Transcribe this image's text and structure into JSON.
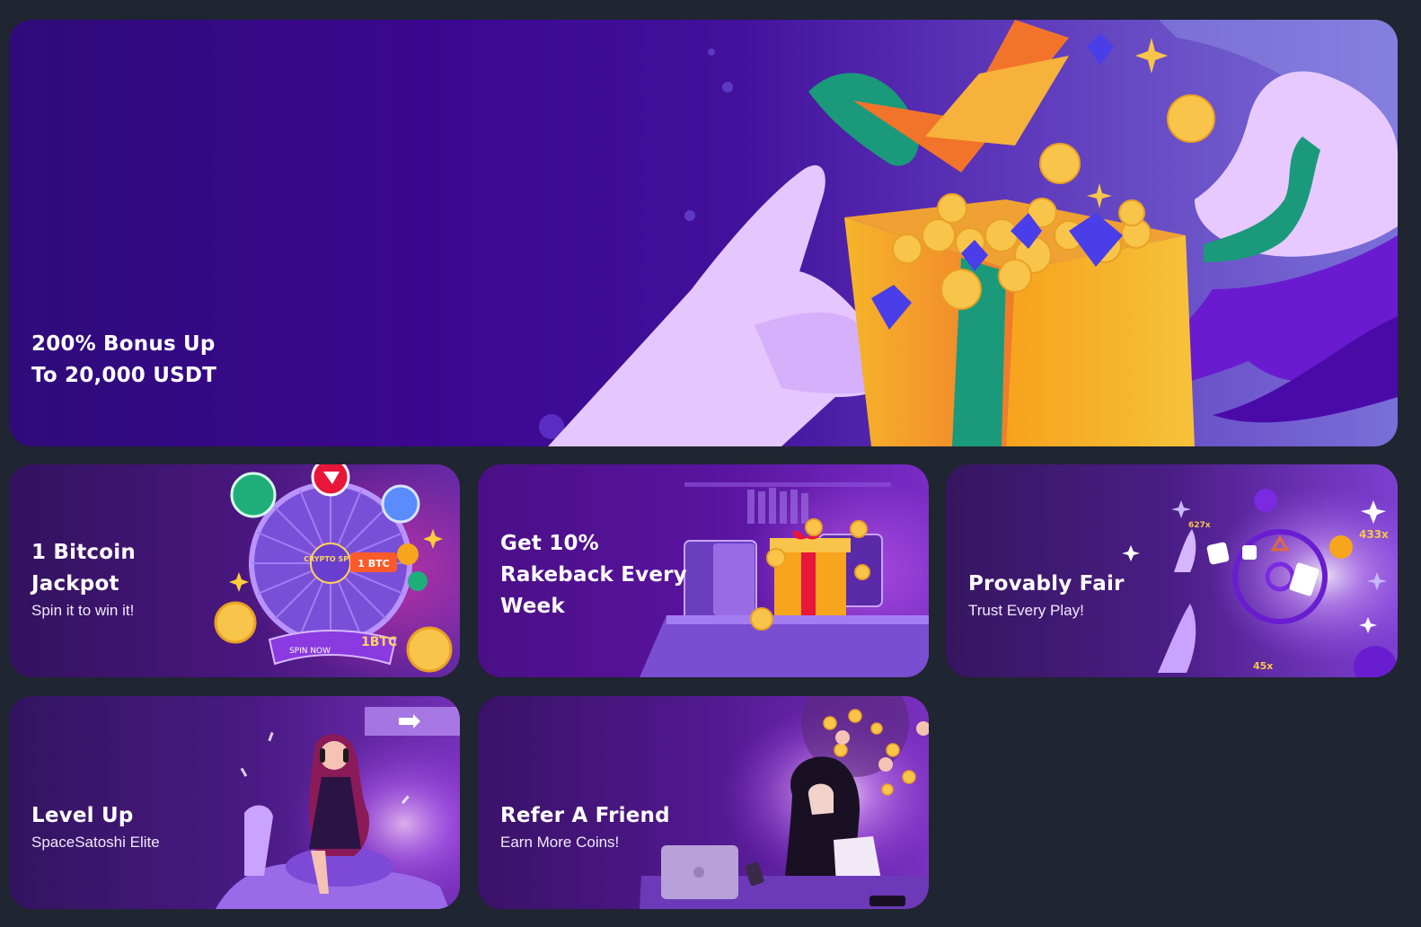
{
  "colors": {
    "page_background": "#1f2531",
    "text": "#ffffff"
  },
  "promos": {
    "hero": {
      "title": "200% Bonus Up\nTo 20,000 USDT",
      "icon": "gift-box-icon"
    },
    "jackpot": {
      "title": "1 Bitcoin\nJackpot",
      "subtitle": "Spin it to win it!",
      "icon": "prize-wheel-icon",
      "wheel_center": "CRYPTO SPIN",
      "wheel_prize": "1 BTC",
      "banner": "SPIN NOW",
      "badge": "1BTC"
    },
    "rakeback": {
      "title": "Get 10%\nRakeback Every\nWeek",
      "icon": "gift-on-desk-icon"
    },
    "fair": {
      "title": "Provably Fair",
      "subtitle": "Trust Every Play!",
      "icon": "rocket-dice-icon",
      "multiplier_a": "433x",
      "multiplier_b": "45x",
      "multiplier_c": "627x"
    },
    "levelup": {
      "title": "Level Up",
      "subtitle": "SpaceSatoshi Elite",
      "icon": "scooter-rider-icon"
    },
    "refer": {
      "title": "Refer A Friend",
      "subtitle": "Earn More Coins!",
      "icon": "laptop-referral-icon"
    }
  }
}
